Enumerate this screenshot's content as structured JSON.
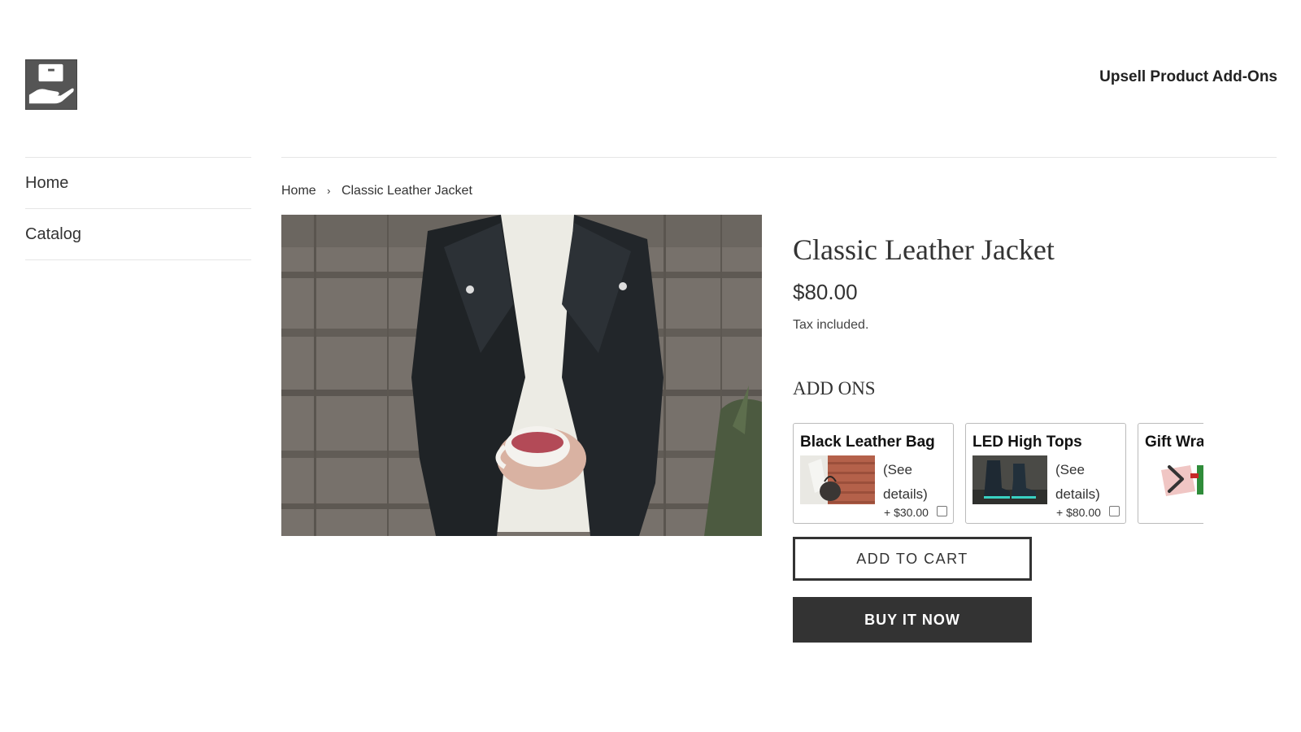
{
  "header": {
    "logo_icon": "hand-box-icon",
    "site_title": "Upsell Product Add-Ons"
  },
  "nav": {
    "items": [
      {
        "label": "Home"
      },
      {
        "label": "Catalog"
      }
    ]
  },
  "breadcrumb": {
    "home": "Home",
    "separator": "›",
    "current": "Classic Leather Jacket"
  },
  "product": {
    "title": "Classic Leather Jacket",
    "price": "$80.00",
    "tax_note": "Tax included.",
    "image_icon": "jacket-photo"
  },
  "addons": {
    "heading": "ADD ONS",
    "items": [
      {
        "name": "Black Leather Bag",
        "details_line1": "(See",
        "details_line2": "details)",
        "price": "+ $30.00",
        "checked": false
      },
      {
        "name": "LED High Tops",
        "details_line1": "(See",
        "details_line2": "details)",
        "price": "+ $80.00",
        "checked": false
      },
      {
        "name": "Gift Wra"
      }
    ],
    "next_icon": "chevron-right-icon"
  },
  "buttons": {
    "add_to_cart": "ADD TO CART",
    "buy_now": "BUY IT NOW"
  }
}
